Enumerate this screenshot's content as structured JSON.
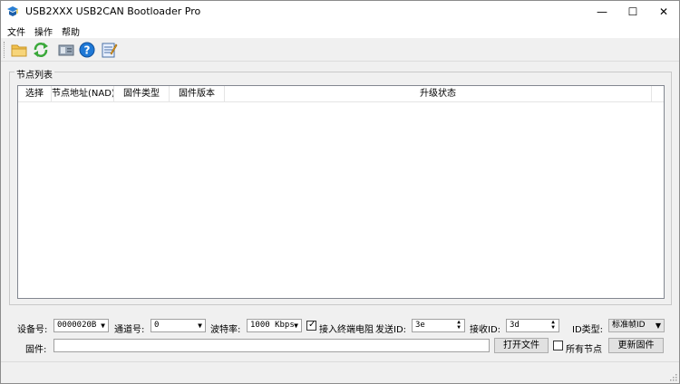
{
  "window": {
    "title": "USB2XXX USB2CAN Bootloader Pro",
    "minimize": "—",
    "maximize": "☐",
    "close": "✕"
  },
  "menu": {
    "items": [
      "文件",
      "操作",
      "帮助"
    ]
  },
  "toolbar": {
    "icons": [
      "folder-icon",
      "refresh-icon",
      "device-icon",
      "help-icon",
      "notepad-icon"
    ]
  },
  "node_list": {
    "group_label": "节点列表",
    "columns": [
      "选择",
      "节点地址(NAD)",
      "固件类型",
      "固件版本",
      "升级状态"
    ]
  },
  "settings": {
    "device_label": "设备号:",
    "device_value": "0000020B",
    "channel_label": "通道号:",
    "channel_value": "0",
    "baud_label": "波特率:",
    "baud_value": "1000 Kbps",
    "terminal_label": "接入终端电阻",
    "terminal_checked": true,
    "send_id_label": "发送ID:",
    "send_id_value": "3e",
    "recv_id_label": "接收ID:",
    "recv_id_value": "3d",
    "id_type_label": "ID类型:",
    "id_type_value": "标准帧ID",
    "firmware_label": "固件:",
    "firmware_value": "",
    "open_file_button": "打开文件",
    "all_nodes_label": "所有节点",
    "all_nodes_checked": false,
    "update_button": "更新固件"
  }
}
